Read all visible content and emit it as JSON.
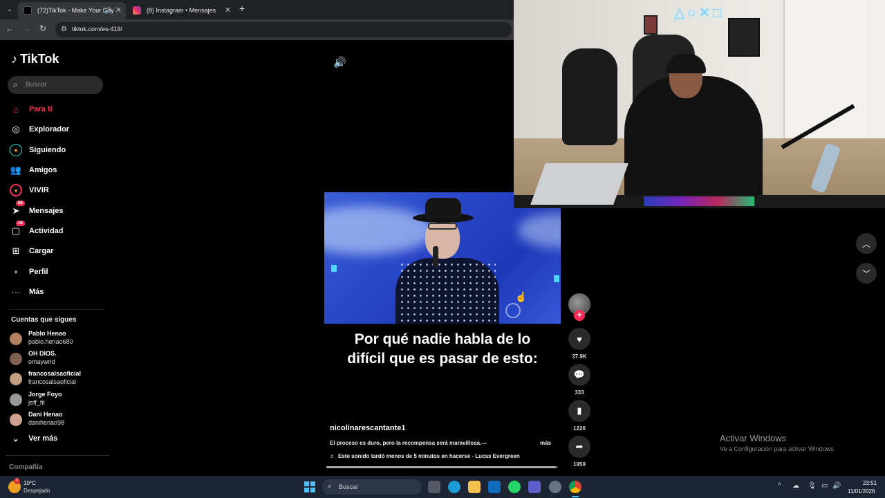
{
  "browser": {
    "tabs": [
      {
        "title": "(72)TikTok - Make Your Day",
        "active": true
      },
      {
        "title": "(8) Instagram • Mensajes",
        "active": false
      }
    ],
    "new_tab": "+",
    "url": "tiktok.com/es-419/"
  },
  "tiktok": {
    "brand": "TikTok",
    "search_placeholder": "Buscar",
    "nav": [
      {
        "label": "Para ti",
        "icon": "home-icon",
        "active": true
      },
      {
        "label": "Explorador",
        "icon": "compass-icon"
      },
      {
        "label": "Siguiendo",
        "icon": "following-icon"
      },
      {
        "label": "Amigos",
        "icon": "friends-icon"
      },
      {
        "label": "VIVIR",
        "icon": "live-icon"
      },
      {
        "label": "Mensajes",
        "icon": "messages-icon",
        "badge": "56"
      },
      {
        "label": "Actividad",
        "icon": "activity-icon",
        "badge": "16"
      },
      {
        "label": "Cargar",
        "icon": "upload-icon"
      },
      {
        "label": "Perfil",
        "icon": "profile-icon"
      },
      {
        "label": "Más",
        "icon": "more-icon"
      }
    ],
    "following_title": "Cuentas que sigues",
    "following": [
      {
        "name": "Pablo Henao",
        "handle": "pablo.henao680"
      },
      {
        "name": "OH DIOS.",
        "handle": "omaywrld"
      },
      {
        "name": "francosalsaoficial",
        "handle": "francosalsaoficial"
      },
      {
        "name": "Jorge Foyo",
        "handle": "jeff_fit"
      },
      {
        "name": "Dani Henao",
        "handle": "danihenao98"
      }
    ],
    "see_more": "Ver más",
    "company": "Compañía"
  },
  "video": {
    "caption": "Por qué nadie habla de lo difícil que es pasar de esto:",
    "author": "nicolinarescantante1",
    "description": "El proceso es duro, pero la recompensa será maravillosa.---",
    "more": "más",
    "music": "Este sonido tardó menos de 5 minutos en hacerse - Lucas Evergreen",
    "progress": 0.99,
    "likes": "37.9K",
    "comments": "333",
    "saves": "1226",
    "shares": "1959"
  },
  "windows_notice": {
    "title": "Activar Windows",
    "subtitle": "Ve a Configuración para activar Windows."
  },
  "taskbar": {
    "temperature": "10°C",
    "weather": "Despejado",
    "search": "Buscar",
    "time": "23:51",
    "date": "11/01/2026"
  }
}
